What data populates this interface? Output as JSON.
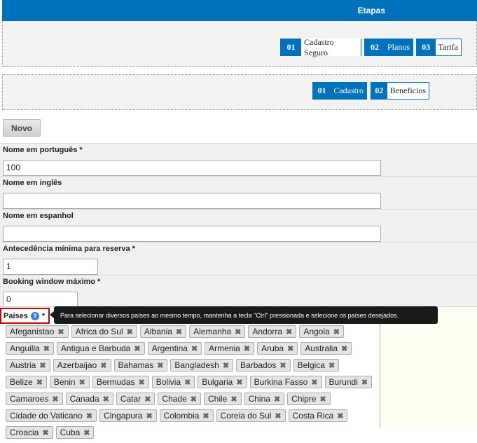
{
  "header": {
    "etapas_label": "Etapas"
  },
  "top_steps": [
    {
      "num": "01",
      "label": "Cadastro Seguro"
    },
    {
      "num": "02",
      "label": "Planos"
    },
    {
      "num": "03",
      "label": "Tarifa"
    }
  ],
  "sub_steps": [
    {
      "num": "01",
      "label": "Cadastro"
    },
    {
      "num": "02",
      "label": "Beneficios"
    }
  ],
  "toolbar": {
    "novo_label": "Novo"
  },
  "form": {
    "nome_pt": {
      "label": "Nome em português *",
      "value": "100"
    },
    "nome_en": {
      "label": "Nome em inglês",
      "value": ""
    },
    "nome_es": {
      "label": "Nome em espanhol",
      "value": ""
    },
    "antecedencia": {
      "label": "Antecedência mínima para reserva *",
      "value": "1"
    },
    "booking_window": {
      "label": "Booking window máximo *",
      "value": "0"
    },
    "paises": {
      "label": "Países",
      "required_mark": "*",
      "help_icon": "?",
      "tooltip": "Para selecionar diversos países ao mesmo tempo, mantenha a tecla \"Ctrl\" pressionada e selecione os países desejados.",
      "remove_glyph": "✖",
      "selected": [
        "Afeganistao",
        "Africa do Sul",
        "Albania",
        "Alemanha",
        "Andorra",
        "Angola",
        "Anguilla",
        "Antigua e Barbuda",
        "Argentina",
        "Armenia",
        "Aruba",
        "Australia",
        "Austria",
        "Azerbaijao",
        "Bahamas",
        "Bangladesh",
        "Barbados",
        "Belgica",
        "Belize",
        "Benin",
        "Bermudas",
        "Bolivia",
        "Bulgaria",
        "Burkina Fasso",
        "Burundi",
        "Camaroes",
        "Canada",
        "Catar",
        "Chade",
        "Chile",
        "China",
        "Chipre",
        "Cidade do Vaticano",
        "Cingapura",
        "Colombia",
        "Coreia do Sul",
        "Costa Rica",
        "Croacia",
        "Cuba"
      ]
    }
  }
}
